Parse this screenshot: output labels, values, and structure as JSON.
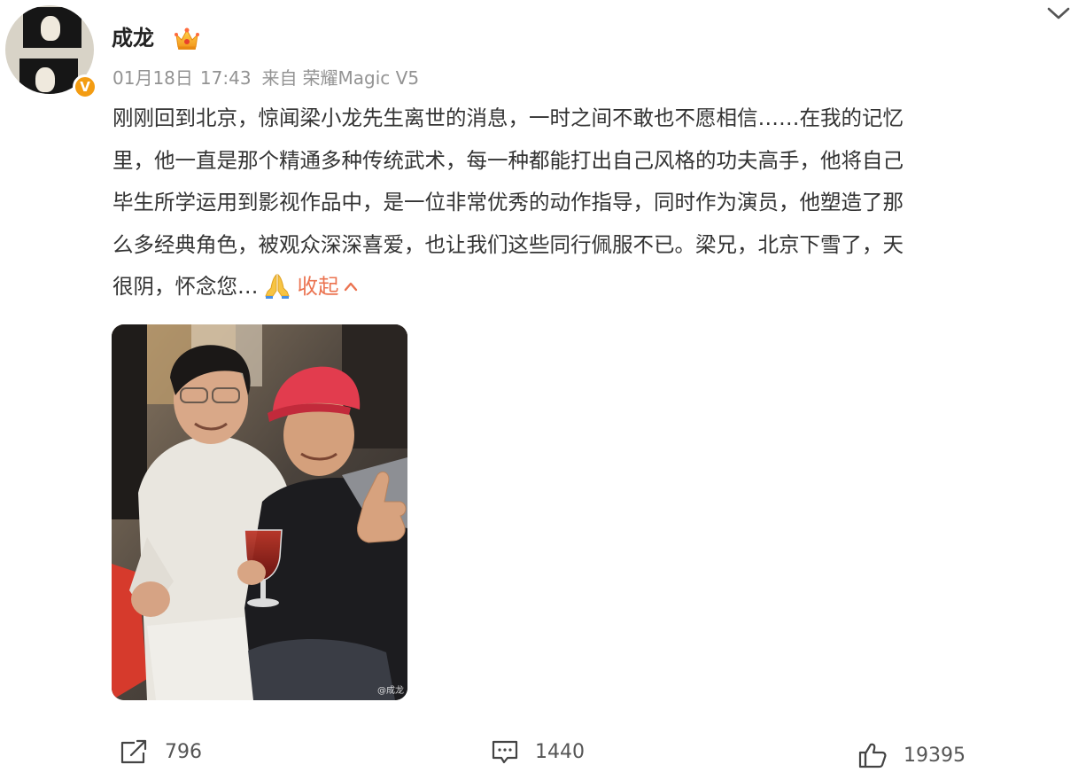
{
  "author": {
    "name": "成龙",
    "verified_badge": "V"
  },
  "post": {
    "date": "01月18日",
    "time": "17:43",
    "source_prefix": "来自",
    "source_device": "荣耀Magic V5",
    "text_lines": [
      "刚刚回到北京，惊闻梁小龙先生离世的消息，一时之间不敢也不愿相信……在我的记忆",
      "里，他一直是那个精通多种传统武术，每一种都能打出自己风格的功夫高手，他将自己",
      "毕生所学运用到影视作品中，是一位非常优秀的动作指导，同时作为演员，他塑造了那",
      "么多经典角色，被观众深深喜爱，也让我们这些同行佩服不已。梁兄，北京下雪了，天",
      "很阴，怀念您…"
    ],
    "collapse_label": "收起",
    "photo_watermark": "@成龙"
  },
  "actions": {
    "repost_count": "796",
    "comment_count": "1440",
    "like_count": "19395"
  },
  "colors": {
    "accent": "#eb7350",
    "meta_gray": "#939393",
    "badge_orange": "#f39c12",
    "text": "#333333"
  },
  "icons": {
    "crown": "crown-icon",
    "expand": "chevron-down-icon",
    "pray": "pray-icon",
    "collapse": "chevron-up-icon",
    "repost": "share-icon",
    "comment": "comment-icon",
    "like": "thumbs-up-icon"
  }
}
